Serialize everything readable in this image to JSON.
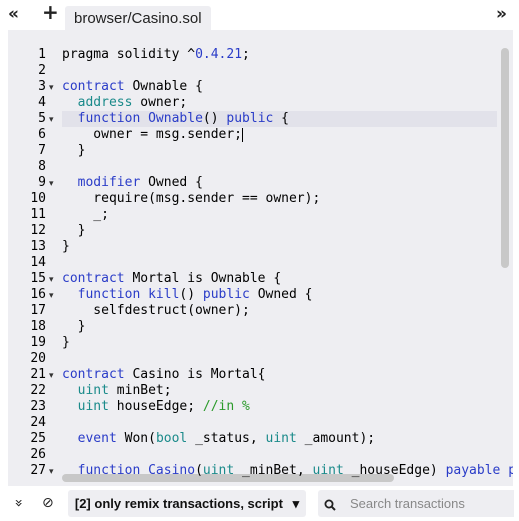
{
  "toolbar": {
    "collapse_left_icon": "«",
    "add_icon": "+",
    "expand_right_icon": "»",
    "tab_label": "browser/Casino.sol"
  },
  "editor": {
    "lines": [
      {
        "n": "1",
        "fold": false,
        "hl": false,
        "tokens": [
          [
            "n",
            "pragma solidity ^"
          ],
          [
            "num",
            "0.4.21"
          ],
          [
            "n",
            ";"
          ]
        ]
      },
      {
        "n": "2",
        "fold": false,
        "hl": false,
        "tokens": []
      },
      {
        "n": "3",
        "fold": true,
        "hl": false,
        "tokens": [
          [
            "k",
            "contract"
          ],
          [
            "n",
            " Ownable {"
          ]
        ]
      },
      {
        "n": "4",
        "fold": false,
        "hl": false,
        "tokens": [
          [
            "n",
            "  "
          ],
          [
            "t",
            "address"
          ],
          [
            "n",
            " owner;"
          ]
        ]
      },
      {
        "n": "5",
        "fold": true,
        "hl": true,
        "tokens": [
          [
            "n",
            "  "
          ],
          [
            "k",
            "function"
          ],
          [
            "n",
            " "
          ],
          [
            "k",
            "Ownable"
          ],
          [
            "n",
            "() "
          ],
          [
            "k",
            "public"
          ],
          [
            "n",
            " {"
          ]
        ]
      },
      {
        "n": "6",
        "fold": false,
        "hl": false,
        "cursor": true,
        "tokens": [
          [
            "n",
            "    owner = msg.sender;"
          ]
        ]
      },
      {
        "n": "7",
        "fold": false,
        "hl": false,
        "tokens": [
          [
            "n",
            "  }"
          ]
        ]
      },
      {
        "n": "8",
        "fold": false,
        "hl": false,
        "tokens": []
      },
      {
        "n": "9",
        "fold": true,
        "hl": false,
        "tokens": [
          [
            "n",
            "  "
          ],
          [
            "k",
            "modifier"
          ],
          [
            "n",
            " Owned {"
          ]
        ]
      },
      {
        "n": "10",
        "fold": false,
        "hl": false,
        "tokens": [
          [
            "n",
            "    require(msg.sender == owner);"
          ]
        ]
      },
      {
        "n": "11",
        "fold": false,
        "hl": false,
        "tokens": [
          [
            "n",
            "    _;"
          ]
        ]
      },
      {
        "n": "12",
        "fold": false,
        "hl": false,
        "tokens": [
          [
            "n",
            "  }"
          ]
        ]
      },
      {
        "n": "13",
        "fold": false,
        "hl": false,
        "tokens": [
          [
            "n",
            "}"
          ]
        ]
      },
      {
        "n": "14",
        "fold": false,
        "hl": false,
        "tokens": []
      },
      {
        "n": "15",
        "fold": true,
        "hl": false,
        "tokens": [
          [
            "k",
            "contract"
          ],
          [
            "n",
            " Mortal is Ownable {"
          ]
        ]
      },
      {
        "n": "16",
        "fold": true,
        "hl": false,
        "tokens": [
          [
            "n",
            "  "
          ],
          [
            "k",
            "function"
          ],
          [
            "n",
            " "
          ],
          [
            "k",
            "kill"
          ],
          [
            "n",
            "() "
          ],
          [
            "k",
            "public"
          ],
          [
            "n",
            " Owned {"
          ]
        ]
      },
      {
        "n": "17",
        "fold": false,
        "hl": false,
        "tokens": [
          [
            "n",
            "    selfdestruct(owner);"
          ]
        ]
      },
      {
        "n": "18",
        "fold": false,
        "hl": false,
        "tokens": [
          [
            "n",
            "  }"
          ]
        ]
      },
      {
        "n": "19",
        "fold": false,
        "hl": false,
        "tokens": [
          [
            "n",
            "}"
          ]
        ]
      },
      {
        "n": "20",
        "fold": false,
        "hl": false,
        "tokens": []
      },
      {
        "n": "21",
        "fold": true,
        "hl": false,
        "tokens": [
          [
            "k",
            "contract"
          ],
          [
            "n",
            " Casino is Mortal{"
          ]
        ]
      },
      {
        "n": "22",
        "fold": false,
        "hl": false,
        "tokens": [
          [
            "n",
            "  "
          ],
          [
            "t",
            "uint"
          ],
          [
            "n",
            " minBet;"
          ]
        ]
      },
      {
        "n": "23",
        "fold": false,
        "hl": false,
        "tokens": [
          [
            "n",
            "  "
          ],
          [
            "t",
            "uint"
          ],
          [
            "n",
            " houseEdge; "
          ],
          [
            "c",
            "//in %"
          ]
        ]
      },
      {
        "n": "24",
        "fold": false,
        "hl": false,
        "tokens": []
      },
      {
        "n": "25",
        "fold": false,
        "hl": false,
        "tokens": [
          [
            "n",
            "  "
          ],
          [
            "k",
            "event"
          ],
          [
            "n",
            " Won("
          ],
          [
            "t",
            "bool"
          ],
          [
            "n",
            " _status, "
          ],
          [
            "t",
            "uint"
          ],
          [
            "n",
            " _amount);"
          ]
        ]
      },
      {
        "n": "26",
        "fold": false,
        "hl": false,
        "tokens": []
      },
      {
        "n": "27",
        "fold": true,
        "hl": false,
        "tokens": [
          [
            "n",
            "  "
          ],
          [
            "k",
            "function"
          ],
          [
            "n",
            " "
          ],
          [
            "k",
            "Casino"
          ],
          [
            "n",
            "("
          ],
          [
            "t",
            "uint"
          ],
          [
            "n",
            " _minBet, "
          ],
          [
            "t",
            "uint"
          ],
          [
            "n",
            " _houseEdge) "
          ],
          [
            "k",
            "payable"
          ],
          [
            "n",
            " "
          ],
          [
            "k",
            "public"
          ]
        ]
      }
    ]
  },
  "bottom": {
    "collapse_icon": "»",
    "clear_icon": "⊘",
    "filter_label": "[2] only remix transactions, script",
    "filter_caret": "▾",
    "search_icon": "🔍",
    "search_placeholder": "Search transactions"
  }
}
